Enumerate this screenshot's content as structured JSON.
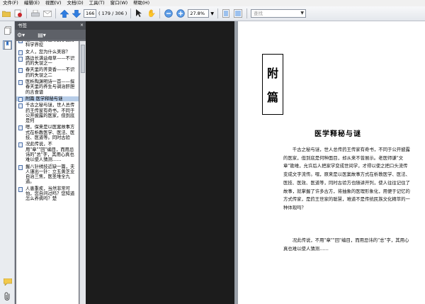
{
  "menu": [
    "文件(F)",
    "编辑(E)",
    "视图(V)",
    "文档(D)",
    "工具(T)",
    "窗口(W)",
    "帮助(H)"
  ],
  "toolbar": {
    "page_current": "166",
    "page_count": "( 179 / 306 )",
    "zoom": "27.8%",
    "search_placeholder": "查找"
  },
  "panel": {
    "title": "书签",
    "close": "×"
  },
  "bookmarks": [
    "治？…重外度导到了西方科学界挖",
    "女人，您为什么美容？",
    "路边长满益母草——不识药的失误之一",
    "春天里的荠菜香——不识药的失误之二",
    "医析陶渊明诗一首——探春天里的养生与调治肝胆的吉食谱",
    "附篇 医学释秘与谜",
    "千古之秘与谜，世人总传药王传家有奇书，不同于公开披露的医家，但到底是何",
    "嗯，保来是以医案故事方式在析教医学、医法、医技、医道等。同时古验",
    "况此传说，不用\"章\"\"回\"编目，而用忌讳的\"总\"字，其用心真也难以使人猜测……",
    "握八针绣技近缺一篇，夫人谨出一针：立五黄芝业自治三焦，医圣堆全九道。",
    "人患重疾，当然非常可怕，您自问过吗？您知道怎么养病吗？楚"
  ],
  "selected_bookmark": 5,
  "document": {
    "title_chars": [
      "附",
      "篇"
    ],
    "heading": "医学释秘与谜",
    "paragraph1": "千古之秘与谜，世人总传药王传家有奇书，不同于公开披露的医家，但到底是何种面目，却从来不曾展示。老医师谦\"文章\"勘难，允许后人把家学变成世间学，才得以使之把口头流传变成文字流传。嘿，原来是以医案故事方式在析教医学、医法、医技、医效、医道等，同时古验方也随讲开列，使人往往记住了故事，就掌握了许多古方，将抽象的医理形象化，用便于记忆的方式传家，是药王世家的聪慧，难道不是传统民族文化精萃的一种体现吗？",
    "paragraph2": "况此传说，不用\"章\"\"回\"编目，而用忌讳的\"总\"字，其用心真也难以使人猜测……"
  }
}
